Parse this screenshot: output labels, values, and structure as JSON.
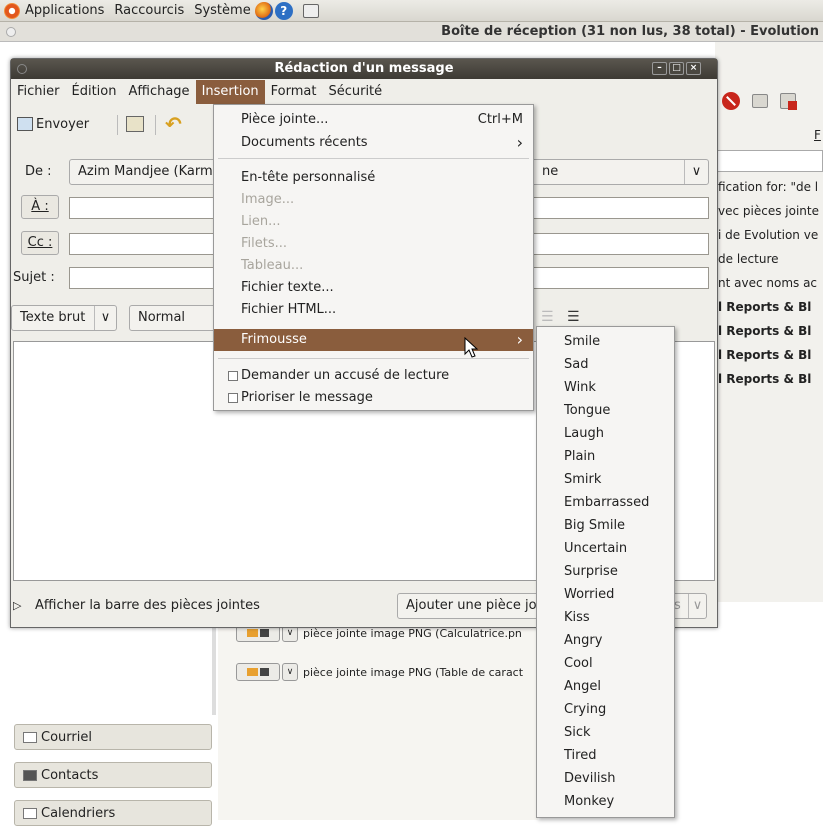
{
  "panel": {
    "applications": "Applications",
    "shortcuts": "Raccourcis",
    "system": "Système"
  },
  "bg": {
    "title": "Boîte de réception (31 non lus, 38 total) - Evolution",
    "rows": [
      "fication for: \"de l",
      "vec pièces jointe",
      "i de Evolution ve",
      "de lecture",
      "nt avec noms ac",
      "l Reports & Bl",
      "l Reports & Bl",
      "l Reports & Bl",
      "l Reports & Bl"
    ],
    "rows_bold": [
      false,
      false,
      false,
      false,
      false,
      true,
      true,
      true,
      true
    ],
    "right_tab": "F",
    "attachments": [
      "pièce jointe image PNG (Calculatrice.pn",
      "pièce jointe image PNG (Table de caract"
    ],
    "left_buttons": [
      "Courriel",
      "Contacts",
      "Calendriers"
    ]
  },
  "compose": {
    "title": "Rédaction d'un message",
    "menus": [
      "Fichier",
      "Édition",
      "Affichage",
      "Insertion",
      "Format",
      "Sécurité"
    ],
    "send": "Envoyer",
    "from_label": "De :",
    "from_value": "Azim Mandjee (Karm",
    "from_tail": "ne",
    "to_label": "À :",
    "cc_label": "Cc :",
    "subject_label": "Sujet :",
    "format": "Texte brut",
    "style": "Normal",
    "show_attach": "Afficher la barre des pièces jointes",
    "add_attach": "Ajouter une pièce jo",
    "attach_tail": "s"
  },
  "insert_menu": [
    {
      "label": "Pièce jointe...",
      "accel": "Ctrl+M",
      "disabled": false
    },
    {
      "label": "Documents récents",
      "accel": "›",
      "disabled": false
    },
    {
      "label": "En-tête personnalisé",
      "disabled": false
    },
    {
      "label": "Image...",
      "disabled": true
    },
    {
      "label": "Lien...",
      "disabled": true
    },
    {
      "label": "Filets...",
      "disabled": true
    },
    {
      "label": "Tableau...",
      "disabled": true
    },
    {
      "label": "Fichier texte...",
      "disabled": false
    },
    {
      "label": "Fichier HTML...",
      "disabled": false
    },
    {
      "label": "Frimousse",
      "accel": "›",
      "disabled": false
    },
    {
      "label": "Demander un accusé de lecture",
      "disabled": false
    },
    {
      "label": "Prioriser le message",
      "disabled": false
    }
  ],
  "smileys": [
    "Smile",
    "Sad",
    "Wink",
    "Tongue",
    "Laugh",
    "Plain",
    "Smirk",
    "Embarrassed",
    "Big Smile",
    "Uncertain",
    "Surprise",
    "Worried",
    "Kiss",
    "Angry",
    "Cool",
    "Angel",
    "Crying",
    "Sick",
    "Tired",
    "Devilish",
    "Monkey"
  ]
}
